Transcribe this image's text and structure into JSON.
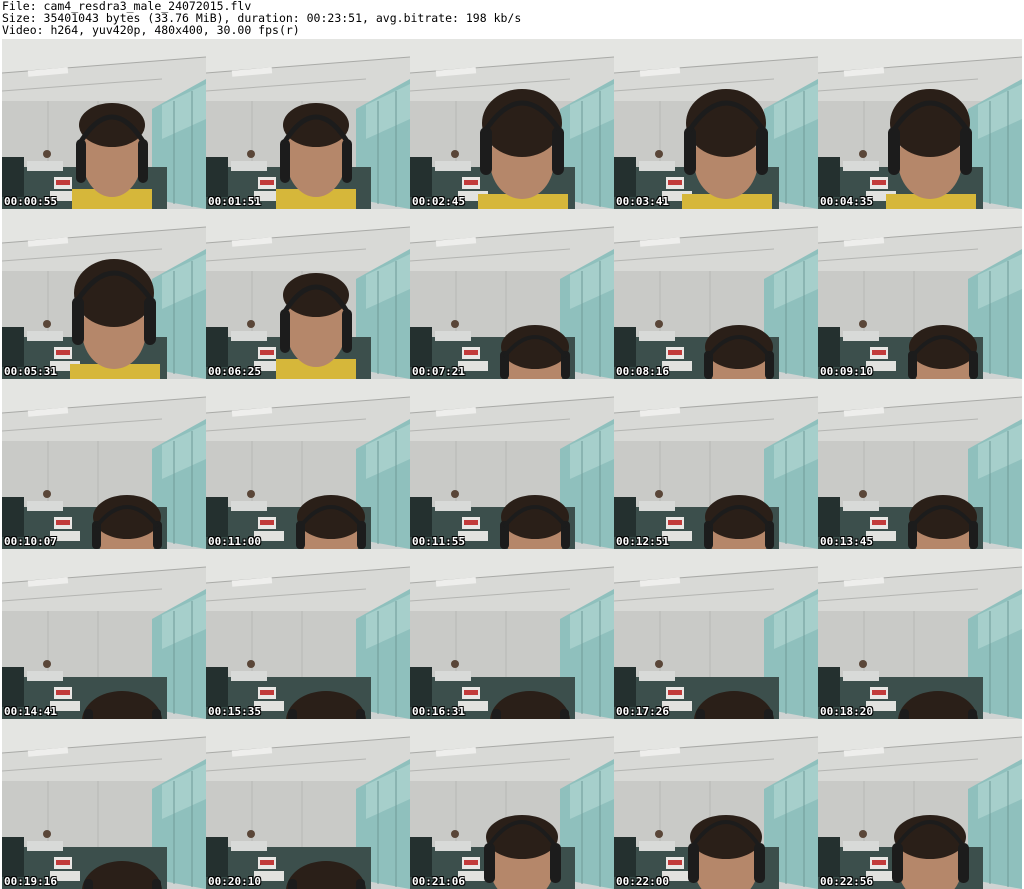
{
  "header": {
    "file_line": "File: cam4_resdra3_male_24072015.flv",
    "size_line": "Size: 35401043 bytes (33.76 MiB), duration: 00:23:51, avg.bitrate: 198 kb/s",
    "video_line": "Video: h264, yuv420p, 480x400, 30.00 fps(r)"
  },
  "colors": {
    "ceiling": "#d8d9d6",
    "wall": "#c9cac7",
    "glass": "#8fc0bd",
    "floor": "#3c4f4c",
    "hair": "#2a1f18",
    "skin": "#b5876a",
    "headphones": "#1c1c1c",
    "shirt": "#d6b73a"
  },
  "frames": [
    {
      "timestamp": "00:00:55",
      "subject_icon": "person-full-face-icon"
    },
    {
      "timestamp": "00:01:51",
      "subject_icon": "person-full-face-icon"
    },
    {
      "timestamp": "00:02:45",
      "subject_icon": "person-looking-down-icon"
    },
    {
      "timestamp": "00:03:41",
      "subject_icon": "person-looking-down-icon"
    },
    {
      "timestamp": "00:04:35",
      "subject_icon": "person-looking-down-icon"
    },
    {
      "timestamp": "00:05:31",
      "subject_icon": "person-looking-down-icon"
    },
    {
      "timestamp": "00:06:25",
      "subject_icon": "person-full-face-icon"
    },
    {
      "timestamp": "00:07:21",
      "subject_icon": "person-low-head-icon"
    },
    {
      "timestamp": "00:08:16",
      "subject_icon": "person-low-head-icon"
    },
    {
      "timestamp": "00:09:10",
      "subject_icon": "person-low-head-icon"
    },
    {
      "timestamp": "00:10:07",
      "subject_icon": "person-low-head-icon"
    },
    {
      "timestamp": "00:11:00",
      "subject_icon": "person-low-head-icon"
    },
    {
      "timestamp": "00:11:55",
      "subject_icon": "person-low-head-icon"
    },
    {
      "timestamp": "00:12:51",
      "subject_icon": "person-low-head-icon"
    },
    {
      "timestamp": "00:13:45",
      "subject_icon": "person-low-head-icon"
    },
    {
      "timestamp": "00:14:41",
      "subject_icon": "person-hair-only-icon"
    },
    {
      "timestamp": "00:15:35",
      "subject_icon": "person-hair-only-icon"
    },
    {
      "timestamp": "00:16:31",
      "subject_icon": "person-hair-only-icon"
    },
    {
      "timestamp": "00:17:26",
      "subject_icon": "person-hair-only-icon"
    },
    {
      "timestamp": "00:18:20",
      "subject_icon": "person-hair-only-icon"
    },
    {
      "timestamp": "00:19:16",
      "subject_icon": "person-hair-only-icon"
    },
    {
      "timestamp": "00:20:10",
      "subject_icon": "person-hair-only-icon"
    },
    {
      "timestamp": "00:21:06",
      "subject_icon": "person-mid-face-icon"
    },
    {
      "timestamp": "00:22:00",
      "subject_icon": "person-mid-face-icon"
    },
    {
      "timestamp": "00:22:56",
      "subject_icon": "person-mid-face-icon"
    }
  ]
}
